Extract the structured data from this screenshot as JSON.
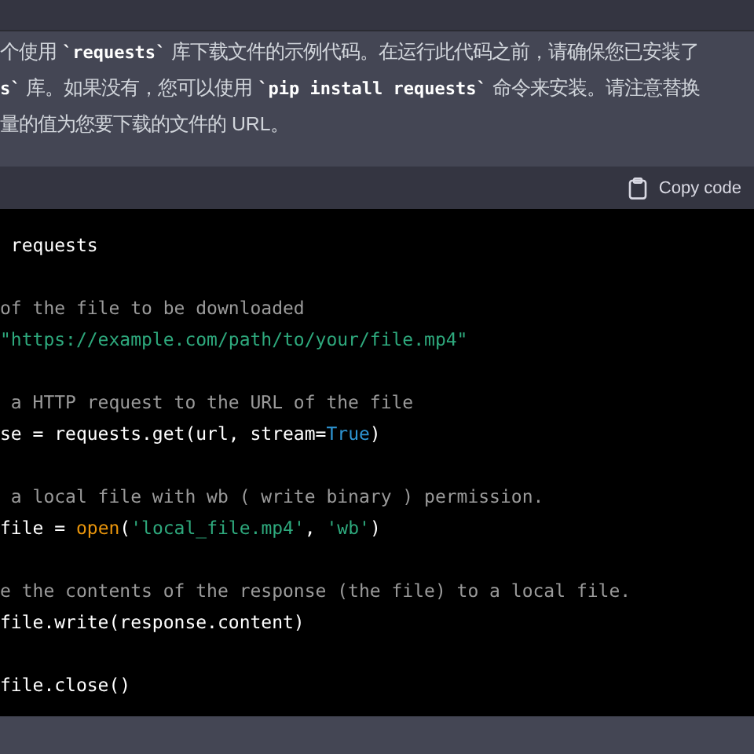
{
  "message": {
    "lines": [
      [
        {
          "kind": "text",
          "text": "个使用 "
        },
        {
          "kind": "code",
          "text": "`requests`"
        },
        {
          "kind": "text",
          "text": " 库下载文件的示例代码。在运行此代码之前，请确保您已安装了"
        }
      ],
      [
        {
          "kind": "code",
          "text": "s`"
        },
        {
          "kind": "text",
          "text": " 库。如果没有，您可以使用 "
        },
        {
          "kind": "code",
          "text": "`pip install requests`"
        },
        {
          "kind": "text",
          "text": " 命令来安装。请注意替换"
        }
      ],
      [
        {
          "kind": "text",
          "text": "量的值为您要下载的文件的 URL。"
        }
      ]
    ]
  },
  "code_block": {
    "copy_label": "Copy code",
    "lines": [
      {
        "tokens": [
          {
            "kind": "plain",
            "text": " requests"
          }
        ]
      },
      {
        "blank_before": true,
        "tokens": [
          {
            "kind": "comment",
            "text": "of the file to be downloaded"
          }
        ]
      },
      {
        "tokens": [
          {
            "kind": "string",
            "text": "\"https://example.com/path/to/your/file.mp4\""
          }
        ]
      },
      {
        "blank_before": true,
        "tokens": [
          {
            "kind": "comment",
            "text": " a HTTP request to the URL of the file"
          }
        ]
      },
      {
        "tokens": [
          {
            "kind": "plain",
            "text": "se = requests.get(url, stream="
          },
          {
            "kind": "keyword",
            "text": "True"
          },
          {
            "kind": "plain",
            "text": ")"
          }
        ]
      },
      {
        "blank_before": true,
        "tokens": [
          {
            "kind": "comment",
            "text": " a local file with wb ( write binary ) permission."
          }
        ]
      },
      {
        "tokens": [
          {
            "kind": "plain",
            "text": "file = "
          },
          {
            "kind": "builtin",
            "text": "open"
          },
          {
            "kind": "plain",
            "text": "("
          },
          {
            "kind": "string",
            "text": "'local_file.mp4'"
          },
          {
            "kind": "plain",
            "text": ", "
          },
          {
            "kind": "string",
            "text": "'wb'"
          },
          {
            "kind": "plain",
            "text": ")"
          }
        ]
      },
      {
        "blank_before": true,
        "tokens": [
          {
            "kind": "comment",
            "text": "e the contents of the response (the file) to a local file."
          }
        ]
      },
      {
        "tokens": [
          {
            "kind": "plain",
            "text": "file.write(response.content)"
          }
        ]
      },
      {
        "blank_before": true,
        "tokens": [
          {
            "kind": "plain",
            "text": "file.close()"
          }
        ]
      }
    ]
  }
}
